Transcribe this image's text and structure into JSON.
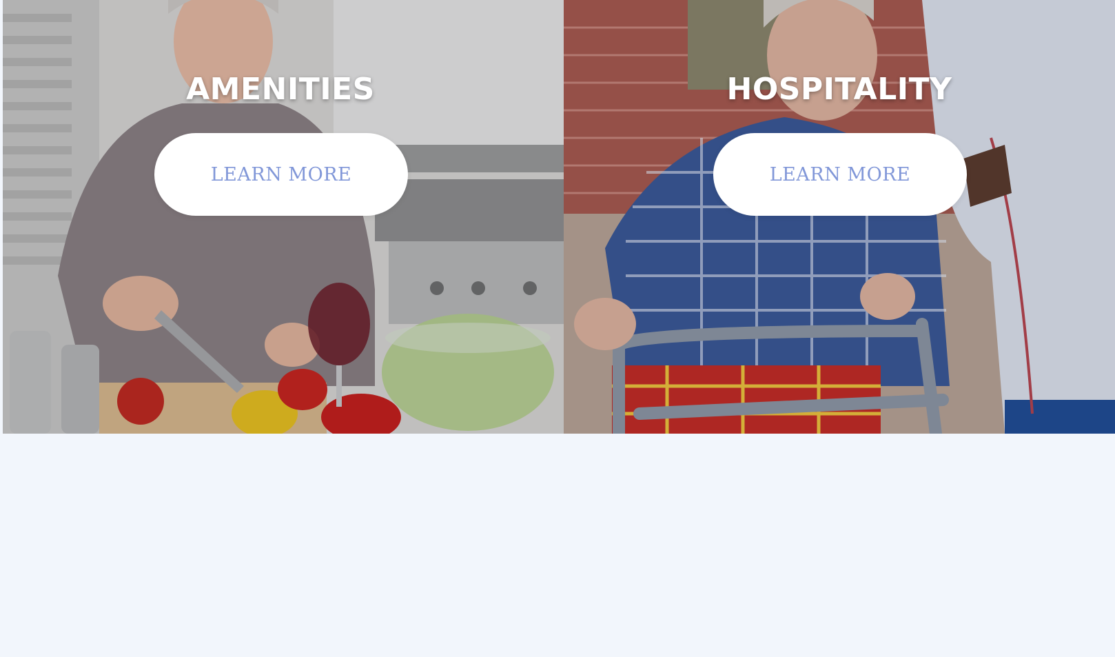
{
  "panels": [
    {
      "title": "AMENITIES",
      "button_label": "LEARN MORE",
      "image": "senior-woman-cooking-salad-photo"
    },
    {
      "title": "HOSPITALITY",
      "button_label": "LEARN MORE",
      "image": "senior-man-walker-caregiver-photo"
    }
  ],
  "colors": {
    "page_background": "#f2f6fc",
    "button_text": "#8197d8",
    "button_background": "#ffffff",
    "title_text": "#ffffff"
  }
}
